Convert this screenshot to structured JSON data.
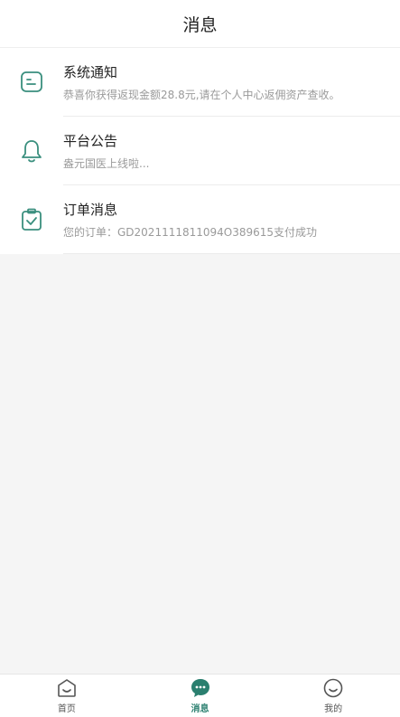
{
  "header": {
    "title": "消息"
  },
  "colors": {
    "accent": "#2a7f6f",
    "icon": "#3a8f7e"
  },
  "messages": [
    {
      "icon": "chat-square-icon",
      "name": "系统通知",
      "desc": "恭喜你获得返现金额28.8元,请在个人中心返佣资产查收。"
    },
    {
      "icon": "bell-icon",
      "name": "平台公告",
      "desc": "盎元国医上线啦..."
    },
    {
      "icon": "clipboard-check-icon",
      "name": "订单消息",
      "desc": "您的订单：GD2021111811094O389615支付成功"
    }
  ],
  "tabbar": {
    "tabs": [
      {
        "icon": "home-icon",
        "label": "首页"
      },
      {
        "icon": "message-icon",
        "label": "消息",
        "active": true
      },
      {
        "icon": "profile-icon",
        "label": "我的"
      }
    ]
  }
}
